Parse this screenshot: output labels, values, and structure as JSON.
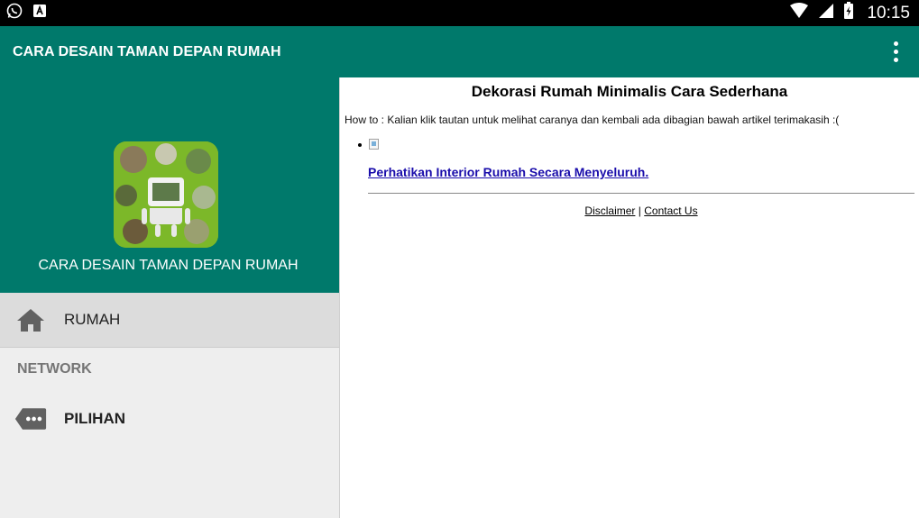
{
  "status_bar": {
    "time": "10:15",
    "left_icons": [
      "whatsapp-icon",
      "text-app-icon"
    ],
    "right_icons": [
      "wifi-icon",
      "signal-icon",
      "battery-charging-icon"
    ]
  },
  "app_bar": {
    "title": "CARA DESAIN TAMAN DEPAN RUMAH",
    "color": "#00796b"
  },
  "drawer": {
    "app_name": "CARA DESAIN TAMAN DEPAN RUMAH",
    "items": [
      {
        "label": "RUMAH",
        "icon": "home-icon",
        "active": true
      }
    ],
    "section": "NETWORK",
    "network_items": [
      {
        "label": "PILIHAN",
        "icon": "tag-more-icon"
      }
    ]
  },
  "content": {
    "title": "Dekorasi Rumah Minimalis Cara Sederhana",
    "howto": "How to : Kalian klik tautan untuk melihat caranya dan kembali ada dibagian bawah artikel terimakasih :(",
    "link": "Perhatikan Interior Rumah Secara Menyeluruh.",
    "footer": {
      "disclaimer": "Disclaimer",
      "separator": "|",
      "contact": "Contact Us"
    }
  }
}
